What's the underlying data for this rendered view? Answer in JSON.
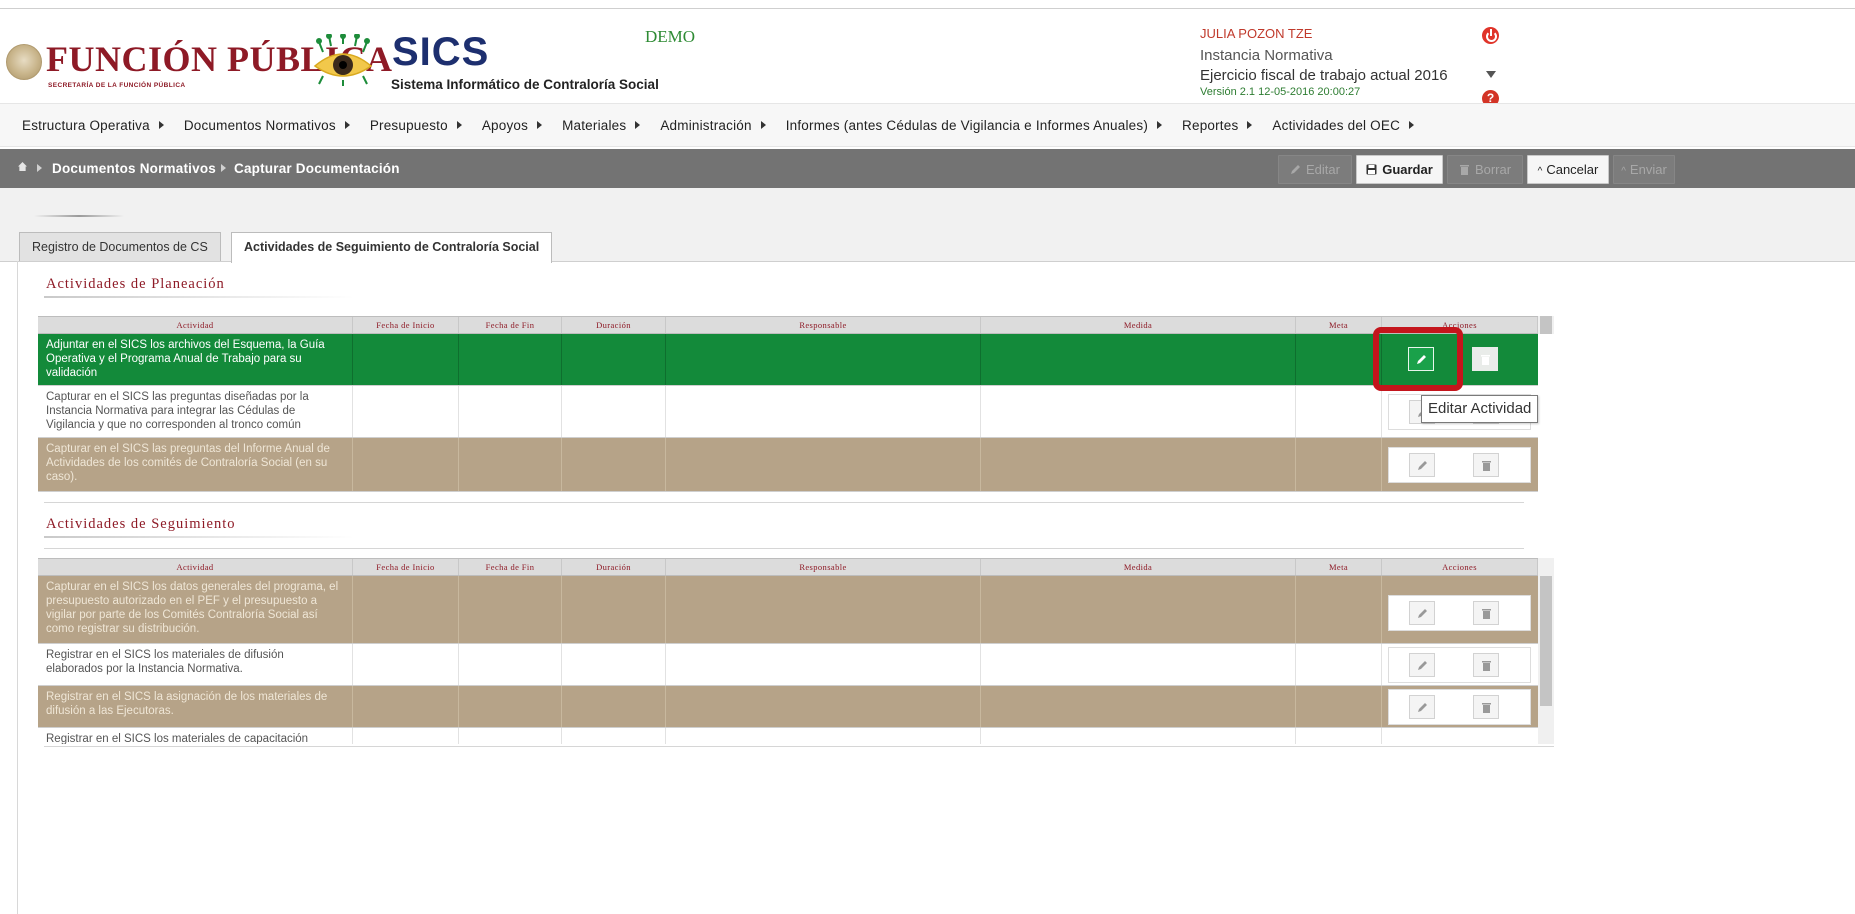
{
  "header": {
    "brand": "FUNCIÓN PÚBLICA",
    "brand_sub": "SECRETARÍA DE LA FUNCIÓN PÚBLICA",
    "app_name": "SICS",
    "app_full": "Sistema Informático de Contraloría Social",
    "env": "DEMO",
    "user_name": "JULIA POZON TZE",
    "user_role": "Instancia Normativa",
    "fiscal": "Ejercicio fiscal de trabajo actual  2016",
    "version": "Versión 2.1    12-05-2016 20:00:27"
  },
  "menu": [
    "Estructura Operativa",
    "Documentos Normativos",
    "Presupuesto",
    "Apoyos",
    "Materiales",
    "Administración",
    "Informes (antes Cédulas de Vigilancia e Informes Anuales)",
    "Reportes",
    "Actividades del OEC"
  ],
  "breadcrumb": [
    "Documentos Normativos",
    "Capturar Documentación"
  ],
  "toolbar": {
    "edit": "Editar",
    "save": "Guardar",
    "delete": "Borrar",
    "cancel": "Cancelar",
    "send": "Enviar"
  },
  "tabs": [
    "Registro de Documentos de CS",
    "Actividades de Seguimiento de Contraloría Social"
  ],
  "columns": [
    "Actividad",
    "Fecha de Inicio",
    "Fecha de Fin",
    "Duración",
    "Responsable",
    "Medida",
    "Meta",
    "Acciones"
  ],
  "planeacion": {
    "title": "Actividades de Planeación",
    "rows": [
      "Adjuntar en el SICS los archivos del Esquema, la Guía Operativa y el Programa Anual de Trabajo para su validación",
      "Capturar en el SICS las preguntas diseñadas por la Instancia Normativa para integrar las Cédulas de Vigilancia y que no corresponden al tronco común",
      "Capturar en el SICS las preguntas del Informe Anual de Actividades de los comités de Contraloría Social (en su caso)."
    ]
  },
  "seguimiento": {
    "title": "Actividades de Seguimiento",
    "rows": [
      "Capturar en el SICS los datos generales del programa, el presupuesto autorizado en el PEF y el presupuesto a vigilar por parte de los Comités Contraloría Social así como registrar su distribución.",
      "Registrar en el SICS los materiales de difusión elaborados por la Instancia Normativa.",
      "Registrar en el SICS la asignación de los materiales de difusión a las Ejecutoras.",
      "Registrar en el SICS los materiales de capacitación"
    ]
  },
  "tooltip": "Editar Actividad",
  "colors": {
    "brand": "#8e1a26",
    "green_row": "#138a3a",
    "tan_row": "#b6a388",
    "highlight": "#c4151c"
  }
}
